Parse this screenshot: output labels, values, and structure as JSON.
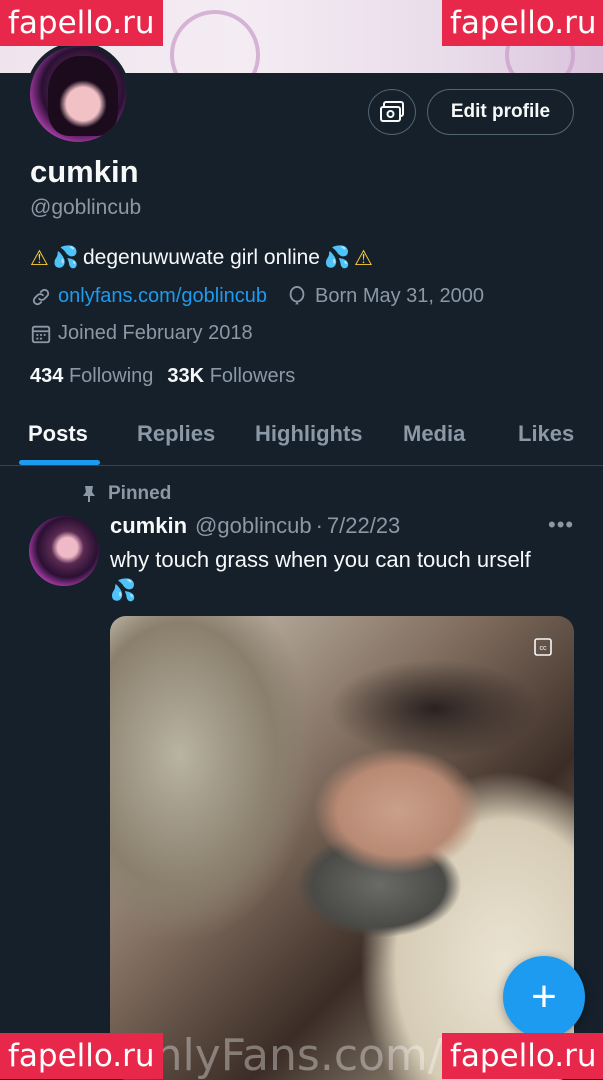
{
  "watermarks": {
    "top_left": "fapello.ru",
    "top_right": "fapello.ru",
    "bottom_left": "fapello.ru",
    "bottom_right": "fapello.ru",
    "center_bottom": "OnlyFans.com/go"
  },
  "profile": {
    "name": "cumkin",
    "handle": "@goblincub",
    "edit_button": "Edit profile",
    "bio_text": "degenuwuwate girl online",
    "link": "onlyfans.com/goblincub",
    "born": "Born May 31, 2000",
    "joined": "Joined February 2018",
    "following_count": "434",
    "following_label": "Following",
    "followers_count": "33K",
    "followers_label": "Followers"
  },
  "tabs": [
    {
      "label": "Posts",
      "active": true
    },
    {
      "label": "Replies",
      "active": false
    },
    {
      "label": "Highlights",
      "active": false
    },
    {
      "label": "Media",
      "active": false
    },
    {
      "label": "Likes",
      "active": false
    }
  ],
  "post": {
    "pinned_label": "Pinned",
    "author_name": "cumkin",
    "author_handle": "@goblincub",
    "separator": "·",
    "date": "7/22/23",
    "text": "why touch grass when you can touch urself"
  },
  "fab_label": "+",
  "colors": {
    "background": "#15202b",
    "accent": "#1d9bf0",
    "muted": "#8b98a5",
    "watermark": "#e8284a"
  }
}
